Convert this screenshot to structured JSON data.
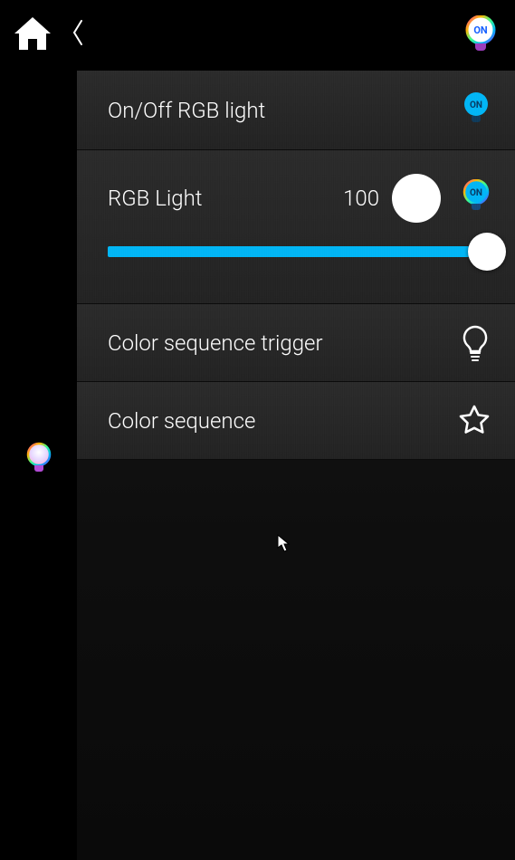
{
  "header": {
    "status_on_label": "ON"
  },
  "rows": {
    "onoff": {
      "label": "On/Off RGB light",
      "state_label": "ON"
    },
    "rgb": {
      "label": "RGB Light",
      "value": "100",
      "state_label": "ON",
      "slider": {
        "min": 0,
        "max": 100,
        "value": 100
      }
    },
    "trigger": {
      "label": "Color sequence trigger"
    },
    "sequence": {
      "label": "Color sequence"
    }
  },
  "colors": {
    "accent": "#00b5f5",
    "swatch": "#ffffff"
  }
}
